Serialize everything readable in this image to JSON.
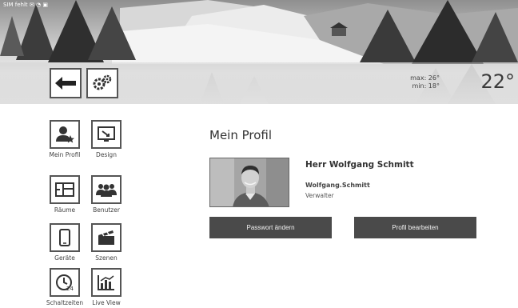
{
  "header": {
    "status_text": "SIM fehlt ✉ ◔ ▣ ",
    "min_max": [
      "max: 26°",
      "min: 18°"
    ],
    "temperature": "22°"
  },
  "toolbar": {
    "back_icon": "arrow-left-icon",
    "settings_icon": "gears-icon"
  },
  "sidebar": {
    "items": [
      {
        "label": "Mein Profil",
        "icon": "user-star-icon"
      },
      {
        "label": "Design",
        "icon": "design-icon"
      },
      {
        "label": "Räume",
        "icon": "floorplan-icon"
      },
      {
        "label": "Benutzer",
        "icon": "users-icon"
      },
      {
        "label": "Geräte",
        "icon": "smartphone-icon"
      },
      {
        "label": "Szenen",
        "icon": "clapperboard-icon"
      },
      {
        "label": "Schaltzeiten",
        "icon": "clock-24-icon"
      },
      {
        "label": "Live View",
        "icon": "bar-chart-icon"
      }
    ]
  },
  "profile": {
    "title": "Mein Profil",
    "name": "Herr Wolfgang Schmitt",
    "username": "Wolfgang.Schmitt",
    "role": "Verwalter",
    "change_password_label": "Passwort ändern",
    "edit_profile_label": "Profil bearbeiten"
  }
}
